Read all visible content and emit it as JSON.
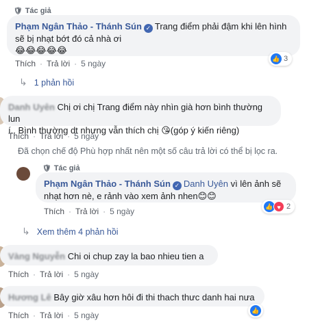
{
  "comment1": {
    "badge": "Tác giả",
    "author": "Phạm Ngân Thảo - Thánh Sún",
    "text_line1": "Trang điểm phải đậm khi lên hình",
    "text_line2": "sẽ bị nhạt bớt đó cả nhà ơi",
    "emojis": "😂😂😂😂😂",
    "like_label": "Thích",
    "reply_label": "Trả lời",
    "time": "5 ngày",
    "reaction_count": "3",
    "replies": "1 phản hồi"
  },
  "comment2": {
    "author": "Danh Uyên",
    "text_line1": "Chị ơi chị Trang điểm này nhìn già hơn bình thường lun",
    "text_line2": "í.. Bình thường dt nhưng vẫn thích chị 😘(góp ý kiến riêng)",
    "like_label": "Thích",
    "reply_label": "Trả lời",
    "time": "5 ngày"
  },
  "filter_notice": "Đã chọn chế độ Phù hợp nhất nên một số câu trả lời có thể bị lọc ra.",
  "reply1": {
    "badge": "Tác giả",
    "author": "Phạm Ngân Thảo - Thánh Sún",
    "mention": "Danh Uyên",
    "text_line1": "vì lên ảnh sẽ",
    "text_line2": "nhạt hơn nè, e rảnh vào xem ảnh nhen😊😊",
    "like_label": "Thích",
    "reply_label": "Trả lời",
    "time": "5 ngày",
    "reaction_count": "2"
  },
  "more_replies": "Xem thêm 4 phản hồi",
  "comment3": {
    "author": "Vàng Nguyễn",
    "text": "Chi oi chup zay la bao nhieu tien a",
    "like_label": "Thích",
    "reply_label": "Trả lời",
    "time": "5 ngày"
  },
  "comment4": {
    "author": "Hương Lê",
    "text": "Bây giờ xâu hơn hôi đi thi thach thưc danh hai nưa",
    "like_label": "Thích",
    "reply_label": "Trả lời",
    "time": "5 ngày"
  },
  "colors": {
    "link": "#385898",
    "bubble": "#f2f3f5",
    "like": "#2078f4",
    "heart": "#f33e58"
  }
}
